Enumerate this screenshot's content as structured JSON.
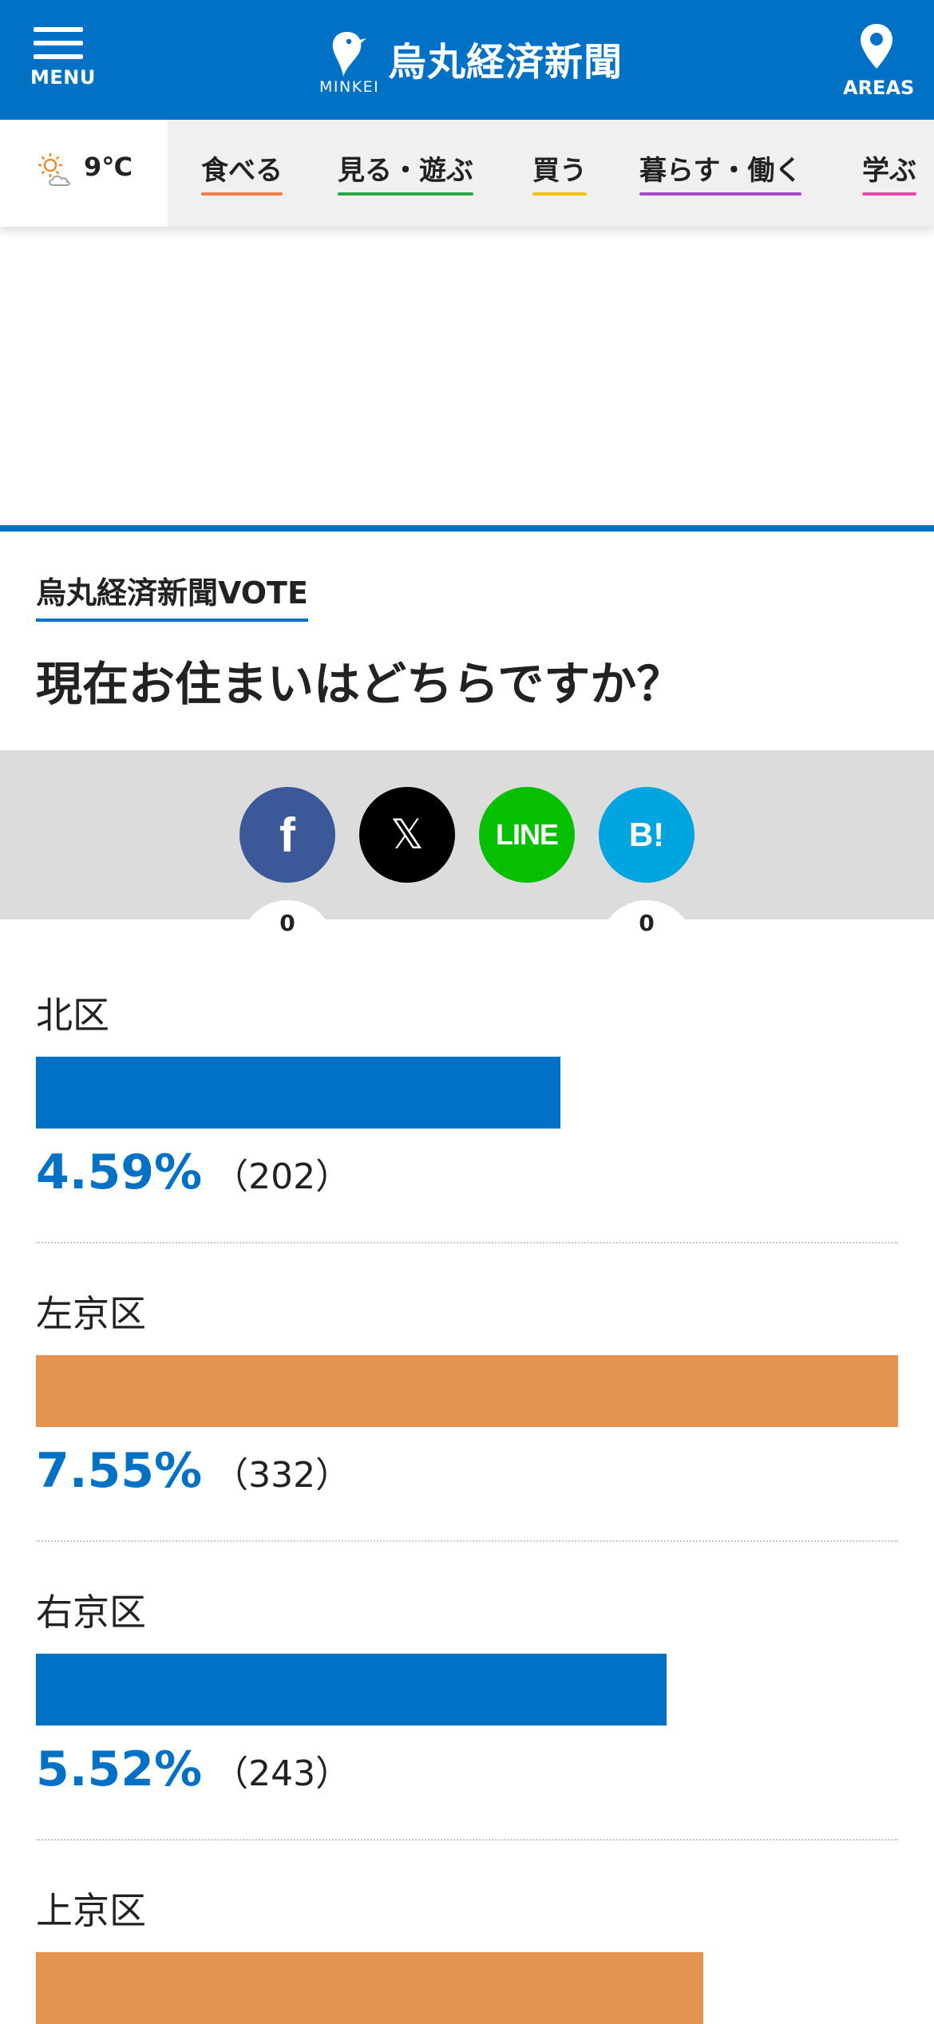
{
  "header": {
    "menu_label": "MENU",
    "logo_text": "MINKEI",
    "site_title": "烏丸経済新聞",
    "areas_label": "AREAS",
    "brand_color": "#0071c5"
  },
  "weather": {
    "icon": "sun-cloud-icon",
    "temperature": "9℃"
  },
  "nav": {
    "items": [
      {
        "label": "食べる",
        "color": "#f07c4a"
      },
      {
        "label": "見る・遊ぶ",
        "color": "#2ba84a"
      },
      {
        "label": "買う",
        "color": "#f2c200"
      },
      {
        "label": "暮らす・働く",
        "color": "#a64ac9"
      },
      {
        "label": "学ぶ",
        "color": "#e84aa8"
      }
    ]
  },
  "vote": {
    "section_label": "烏丸経済新聞VOTE",
    "question": "現在お住まいはどちらですか？"
  },
  "share": {
    "facebook": {
      "icon": "facebook-icon",
      "label": "f",
      "count": "0",
      "color": "#3b5998"
    },
    "x": {
      "icon": "x-icon",
      "label": "𝕏",
      "color": "#000000"
    },
    "line": {
      "icon": "line-icon",
      "label": "LINE",
      "color": "#06c000"
    },
    "hatena": {
      "icon": "hatena-bookmark-icon",
      "label": "B!",
      "count": "0",
      "color": "#00a4de"
    }
  },
  "results": [
    {
      "name": "北区",
      "percent": "4.59%",
      "count": "（202）",
      "votes": 202,
      "color": "#0071c5"
    },
    {
      "name": "左京区",
      "percent": "7.55%",
      "count": "（332）",
      "votes": 332,
      "color": "#e49450"
    },
    {
      "name": "右京区",
      "percent": "5.52%",
      "count": "（243）",
      "votes": 243,
      "color": "#0071c5"
    },
    {
      "name": "上京区",
      "percent": "",
      "count": "",
      "votes": 257,
      "color": "#e49450"
    }
  ]
}
